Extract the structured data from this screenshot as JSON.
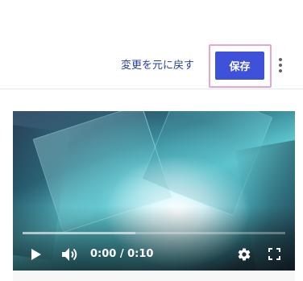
{
  "toolbar": {
    "revert_label": "変更を元に戻す",
    "save_label": "保存",
    "more_icon": "more-vert-icon",
    "accent_color": "#3f51d9",
    "highlight_color": "#e8a6cf"
  },
  "video": {
    "time_display": "0:00 / 0:10",
    "played_fraction": 0.0,
    "buffered_fraction": 0.43,
    "controls": {
      "play_icon": "play-icon",
      "volume_icon": "volume-icon",
      "settings_icon": "gear-icon",
      "fullscreen_icon": "fullscreen-icon"
    }
  }
}
